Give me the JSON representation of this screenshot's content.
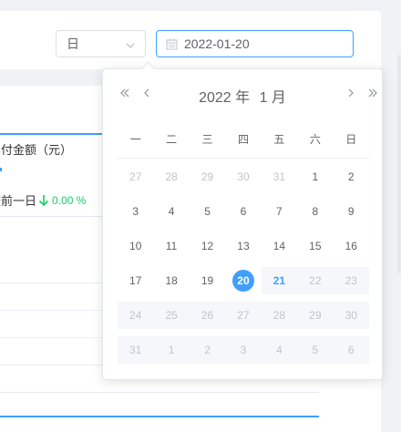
{
  "filter": {
    "granularity_select": "日",
    "date_value": "2022-01-20"
  },
  "metric": {
    "label": "实付金额（元）",
    "compare_label": "较前一日",
    "change_value": "0.00 %"
  },
  "colors": {
    "accent": "#409eff",
    "down": "#13ce66",
    "muted": "#c0c4cc"
  },
  "picker": {
    "year": "2022 年",
    "month": "1 月",
    "prev_year_icon": "double-chevron-left-icon",
    "prev_month_icon": "chevron-left-icon",
    "next_month_icon": "chevron-right-icon",
    "next_year_icon": "double-chevron-right-icon",
    "weekdays": [
      "一",
      "二",
      "三",
      "四",
      "五",
      "六",
      "日"
    ],
    "weeks": [
      [
        {
          "d": "27",
          "t": "other"
        },
        {
          "d": "28",
          "t": "other"
        },
        {
          "d": "29",
          "t": "other"
        },
        {
          "d": "30",
          "t": "other"
        },
        {
          "d": "31",
          "t": "other"
        },
        {
          "d": "1",
          "t": "normal"
        },
        {
          "d": "2",
          "t": "normal"
        }
      ],
      [
        {
          "d": "3",
          "t": "normal"
        },
        {
          "d": "4",
          "t": "normal"
        },
        {
          "d": "5",
          "t": "normal"
        },
        {
          "d": "6",
          "t": "normal"
        },
        {
          "d": "7",
          "t": "normal"
        },
        {
          "d": "8",
          "t": "normal"
        },
        {
          "d": "9",
          "t": "normal"
        }
      ],
      [
        {
          "d": "10",
          "t": "normal"
        },
        {
          "d": "11",
          "t": "normal"
        },
        {
          "d": "12",
          "t": "normal"
        },
        {
          "d": "13",
          "t": "normal"
        },
        {
          "d": "14",
          "t": "normal"
        },
        {
          "d": "15",
          "t": "normal"
        },
        {
          "d": "16",
          "t": "normal"
        }
      ],
      [
        {
          "d": "17",
          "t": "normal"
        },
        {
          "d": "18",
          "t": "normal"
        },
        {
          "d": "19",
          "t": "normal"
        },
        {
          "d": "20",
          "t": "selected"
        },
        {
          "d": "21",
          "t": "today-disabled"
        },
        {
          "d": "22",
          "t": "disabled"
        },
        {
          "d": "23",
          "t": "disabled"
        }
      ],
      [
        {
          "d": "24",
          "t": "disabled"
        },
        {
          "d": "25",
          "t": "disabled"
        },
        {
          "d": "26",
          "t": "disabled"
        },
        {
          "d": "27",
          "t": "disabled"
        },
        {
          "d": "28",
          "t": "disabled"
        },
        {
          "d": "29",
          "t": "disabled"
        },
        {
          "d": "30",
          "t": "disabled"
        }
      ],
      [
        {
          "d": "31",
          "t": "disabled"
        },
        {
          "d": "1",
          "t": "disabled"
        },
        {
          "d": "2",
          "t": "disabled"
        },
        {
          "d": "3",
          "t": "disabled"
        },
        {
          "d": "4",
          "t": "disabled"
        },
        {
          "d": "5",
          "t": "disabled"
        },
        {
          "d": "6",
          "t": "disabled"
        }
      ]
    ]
  }
}
